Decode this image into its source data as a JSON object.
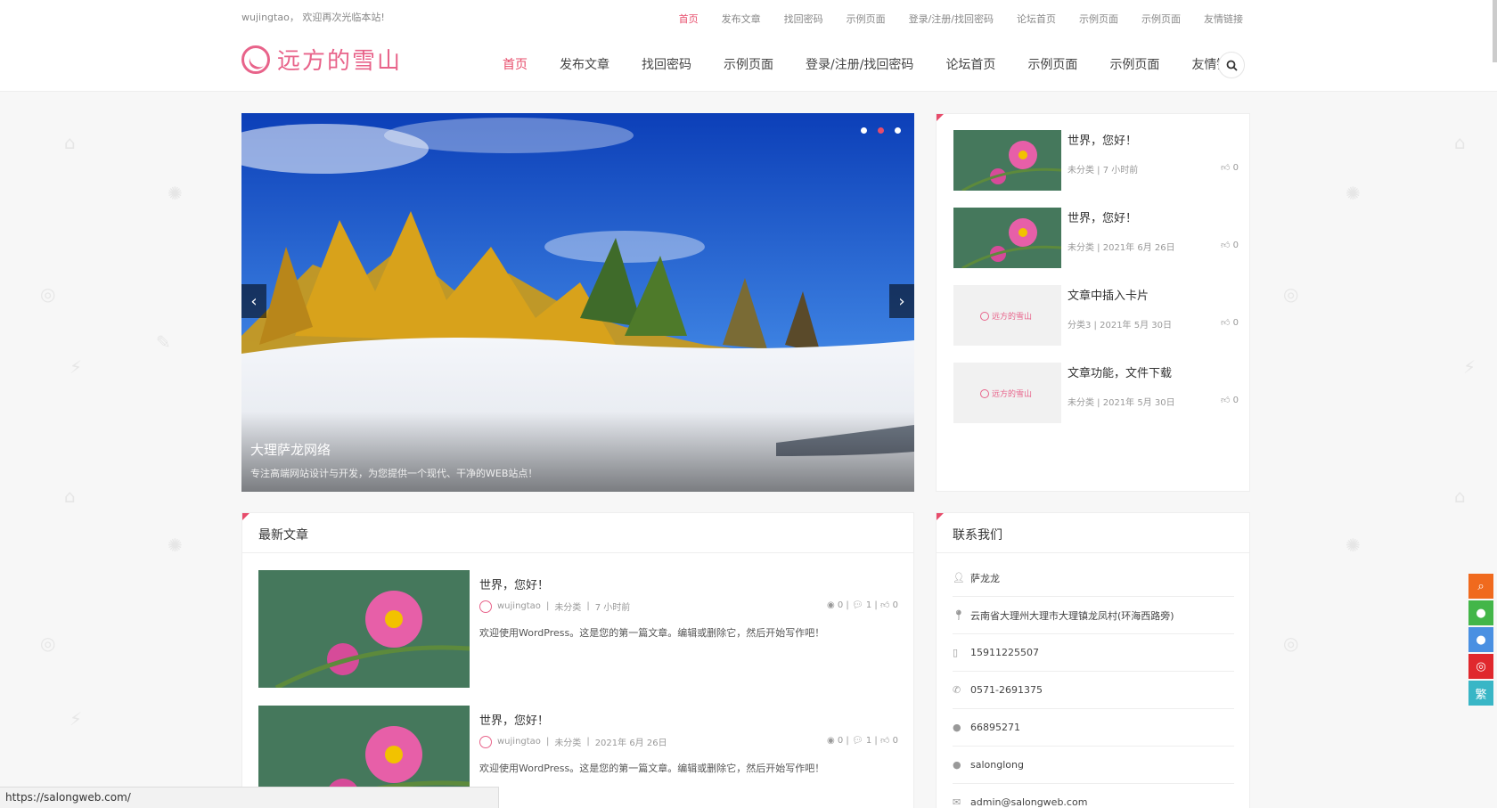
{
  "header": {
    "welcome": "wujingtao， 欢迎再次光临本站!",
    "top_nav": [
      "首页",
      "发布文章",
      "找回密码",
      "示例页面",
      "登录/注册/找回密码",
      "论坛首页",
      "示例页面",
      "示例页面",
      "友情链接"
    ],
    "logo_text": "远方的雪山",
    "main_nav": [
      "首页",
      "发布文章",
      "找回密码",
      "示例页面",
      "登录/注册/找回密码",
      "论坛首页",
      "示例页面",
      "示例页面",
      "友情链接"
    ],
    "search_icon": "search-icon"
  },
  "slider": {
    "title": "大理萨龙网络",
    "description": "专注高端网站设计与开发，为您提供一个现代、干净的WEB站点！",
    "dots": 3,
    "active_dot": 1
  },
  "side_posts": [
    {
      "title": "世界，您好！",
      "category": "未分类",
      "date": "7 小时前",
      "likes": "0",
      "thumb": "flower"
    },
    {
      "title": "世界，您好！",
      "category": "未分类",
      "date": "2021年 6月 26日",
      "likes": "0",
      "thumb": "flower"
    },
    {
      "title": "文章中插入卡片",
      "category": "分类3",
      "date": "2021年 5月 30日",
      "likes": "0",
      "thumb": "placeholder"
    },
    {
      "title": "文章功能，文件下载",
      "category": "未分类",
      "date": "2021年 5月 30日",
      "likes": "0",
      "thumb": "placeholder"
    }
  ],
  "placeholder_logo": "远方的雪山",
  "latest": {
    "title": "最新文章",
    "posts": [
      {
        "title": "世界，您好！",
        "author": "wujingtao",
        "category": "未分类",
        "date": "7 小时前",
        "views": "0",
        "comments": "1",
        "likes": "0",
        "excerpt": "欢迎使用WordPress。这是您的第一篇文章。编辑或删除它，然后开始写作吧！"
      },
      {
        "title": "世界，您好！",
        "author": "wujingtao",
        "category": "未分类",
        "date": "2021年 6月 26日",
        "views": "0",
        "comments": "1",
        "likes": "0",
        "excerpt": "欢迎使用WordPress。这是您的第一篇文章。编辑或删除它，然后开始写作吧！"
      }
    ]
  },
  "contact": {
    "title": "联系我们",
    "items": [
      {
        "icon": "user-icon",
        "text": "萨龙龙"
      },
      {
        "icon": "map-marker-icon",
        "text": "云南省大理州大理市大理镇龙凤村(环海西路旁)"
      },
      {
        "icon": "mobile-icon",
        "text": "15911225507"
      },
      {
        "icon": "phone-icon",
        "text": "0571-2691375"
      },
      {
        "icon": "qq-icon",
        "text": "66895271"
      },
      {
        "icon": "wechat-icon",
        "text": "salonglong"
      },
      {
        "icon": "email-icon",
        "text": "admin@salongweb.com"
      }
    ]
  },
  "float_buttons": [
    {
      "icon": "search-icon",
      "color": "#f06a1e"
    },
    {
      "icon": "wechat-icon",
      "color": "#43b649"
    },
    {
      "icon": "qq-icon",
      "color": "#4a90e2"
    },
    {
      "icon": "weibo-icon",
      "color": "#e0282d"
    },
    {
      "icon": "traditional-chinese-icon",
      "label": "繁",
      "color": "#39b6c6"
    }
  ],
  "status_url": "https://salongweb.com/",
  "colors": {
    "accent": "#e74c6b",
    "logo": "#e8638a"
  }
}
